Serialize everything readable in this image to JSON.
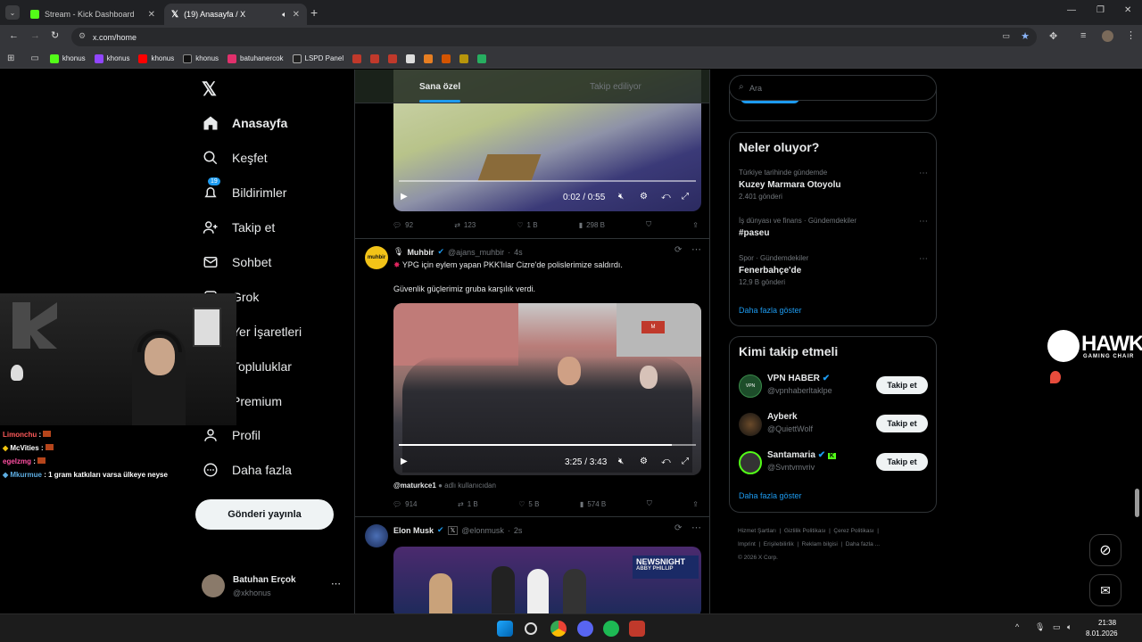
{
  "browser": {
    "tabs": [
      {
        "title": "Stream - Kick Dashboard"
      },
      {
        "title": "(19) Anasayfa / X"
      }
    ],
    "url": "x.com/home",
    "bookmarks": [
      "khonus",
      "khonus",
      "khonus",
      "khonus",
      "batuhanercok",
      "LSPD Panel"
    ]
  },
  "sidebar": {
    "items": [
      {
        "label": "Anasayfa",
        "icon": "home-icon"
      },
      {
        "label": "Keşfet",
        "icon": "search-icon"
      },
      {
        "label": "Bildirimler",
        "icon": "bell-icon",
        "badge": "19"
      },
      {
        "label": "Takip et",
        "icon": "add-person-icon"
      },
      {
        "label": "Sohbet",
        "icon": "mail-icon"
      },
      {
        "label": "Grok",
        "icon": "grok-icon"
      },
      {
        "label": "Yer İşaretleri",
        "icon": "bookmark-icon"
      },
      {
        "label": "Topluluklar",
        "icon": "people-icon"
      },
      {
        "label": "Premium",
        "icon": "x-icon"
      },
      {
        "label": "Profil",
        "icon": "person-icon"
      },
      {
        "label": "Daha fazla",
        "icon": "more-icon"
      }
    ],
    "post_button": "Gönderi yayınla",
    "account": {
      "name": "Batuhan Erçok",
      "handle": "@xkhonus"
    }
  },
  "feed_tabs": {
    "for_you": "Sana özel",
    "following": "Takip ediliyor"
  },
  "tweets": [
    {
      "video_time": "0:02 / 0:55",
      "replies": "92",
      "retweets": "123",
      "likes": "1 B",
      "views": "298 B"
    },
    {
      "name": "Muhbir",
      "handle": "@ajans_muhbir",
      "time": "4s",
      "avatar_text": "muhbir",
      "text1": "YPG için eylem yapan PKK'lılar Cizre'de polislerimize saldırdı.",
      "text2": "Güvenlik güçlerimiz gruba karşılık verdi.",
      "video_time": "3:25 / 3:43",
      "credit_user": "@maturkce1",
      "credit_suffix": "adlı kullanıcıdan",
      "replies": "914",
      "retweets": "1 B",
      "likes": "5 B",
      "views": "574 B"
    },
    {
      "name": "Elon Musk",
      "handle": "@elonmusk",
      "time": "2s",
      "banner": "NEWSNIGHT",
      "banner2": "ABBY PHILLIP"
    }
  ],
  "search": {
    "placeholder": "Ara"
  },
  "trends": {
    "title": "Neler oluyor?",
    "items": [
      {
        "context": "Türkiye tarihinde gündemde",
        "name": "Kuzey Marmara Otoyolu",
        "count": "2.401 gönderi"
      },
      {
        "context": "İş dünyası ve finans · Gündemdekiler",
        "name": "#paseu",
        "count": ""
      },
      {
        "context": "Spor · Gündemdekiler",
        "name": "Fenerbahçe'de",
        "count": "12,9 B gönderi"
      }
    ],
    "more": "Daha fazla göster"
  },
  "who_to_follow": {
    "title": "Kimi takip etmeli",
    "items": [
      {
        "name": "VPN HABER",
        "handle": "@vpnhaberltaklpe",
        "button": "Takip et"
      },
      {
        "name": "Ayberk",
        "handle": "@QuiettWolf",
        "button": "Takip et"
      },
      {
        "name": "Santamaria",
        "handle": "@Svntvmvriv",
        "button": "Takip et"
      }
    ],
    "more": "Daha fazla göster"
  },
  "footer": [
    "Hizmet Şartları",
    "Gizlilik Politikası",
    "Çerez Politikası",
    "Imprint",
    "Erişilebilirlik",
    "Reklam bilgisi",
    "Daha fazla ...",
    "© 2026 X Corp."
  ],
  "stream_chat": [
    {
      "user": "Limonchu",
      "msg": ":"
    },
    {
      "user": "McVities",
      "msg": ":"
    },
    {
      "user": "egelzmg",
      "msg": ":"
    },
    {
      "user": "Mkurmue",
      "msg": ": 1 gram katkıları varsa ülkeye neyse"
    }
  ],
  "overlay_brand": {
    "name": "HAWK",
    "sub": "GAMING CHAIR"
  },
  "taskbar": {
    "time": "21:38",
    "date": "8.01.2026"
  },
  "colors": {
    "accent": "#1d9bf0",
    "bg": "#000000",
    "border": "#2f3336"
  }
}
